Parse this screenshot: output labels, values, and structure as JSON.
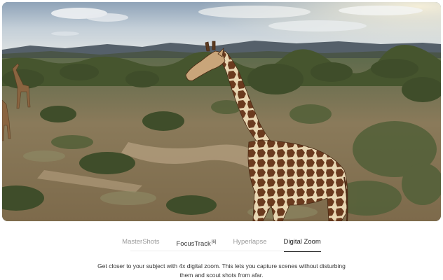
{
  "hero": {
    "alt": "Giraffes in a savanna landscape filmed in digital zoom"
  },
  "tabs": [
    {
      "label": "MasterShots",
      "footnote": "",
      "state": "inactive"
    },
    {
      "label": "FocusTrack",
      "footnote": "[6]",
      "state": "hover"
    },
    {
      "label": "Hyperlapse",
      "footnote": "",
      "state": "inactive"
    },
    {
      "label": "Digital Zoom",
      "footnote": "",
      "state": "active"
    }
  ],
  "description": {
    "line1": "Get closer to your subject with 4x digital zoom. This lets you capture scenes without disturbing",
    "line2": "them and scout shots from afar."
  }
}
